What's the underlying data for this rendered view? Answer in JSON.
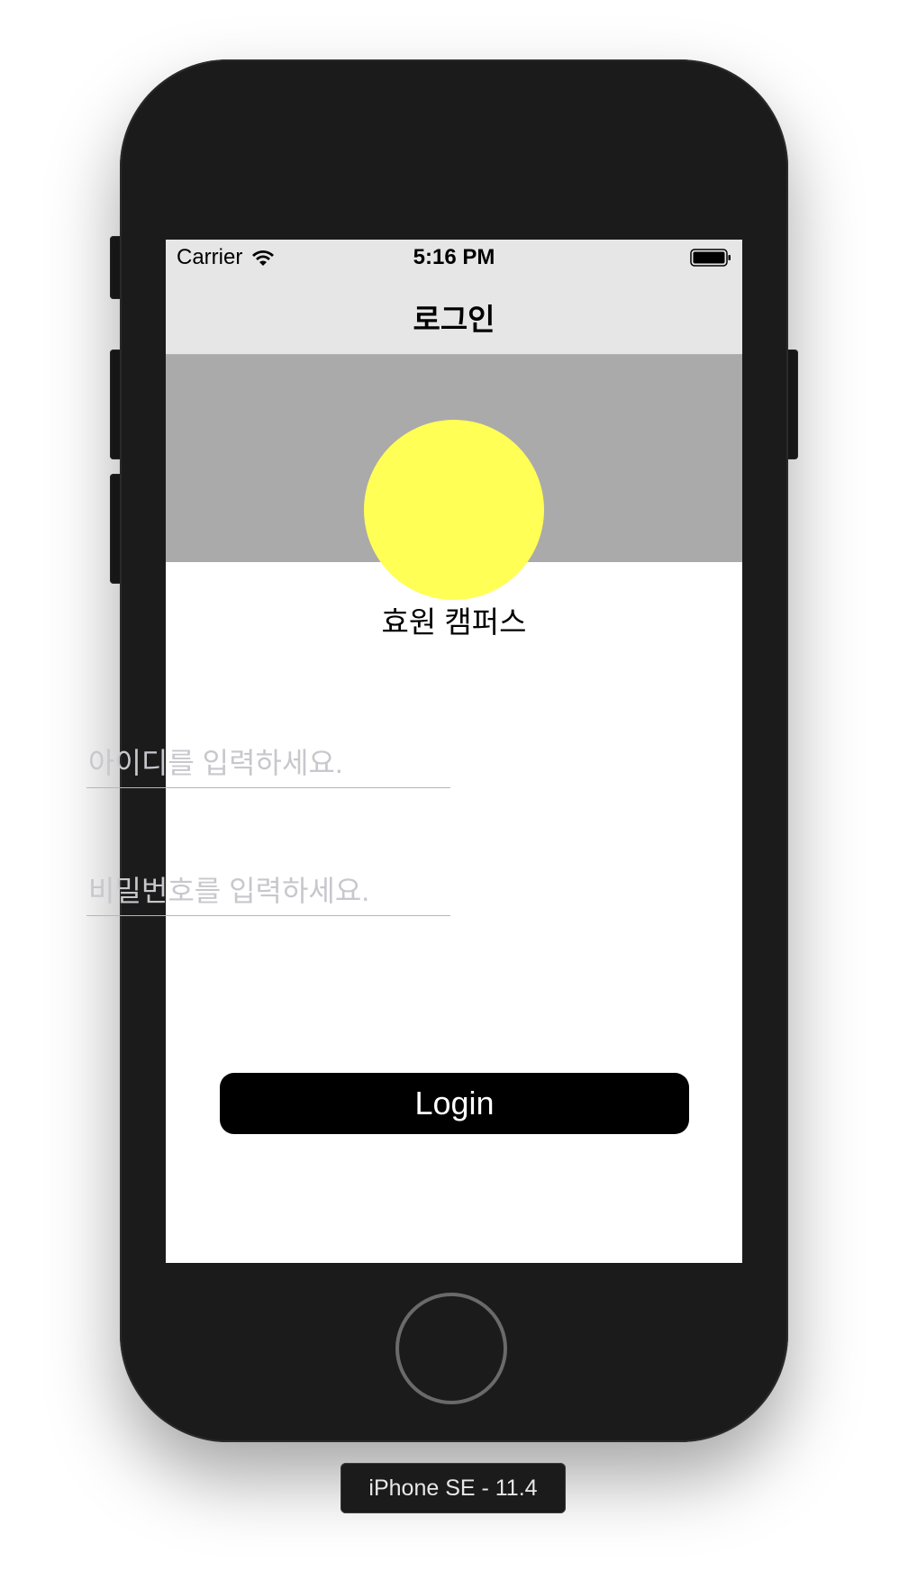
{
  "status_bar": {
    "carrier": "Carrier",
    "time": "5:16 PM",
    "wifi_icon": "wifi-icon",
    "battery_icon": "battery-full-icon"
  },
  "nav": {
    "title": "로그인"
  },
  "header": {
    "band_color": "#aaaaaa",
    "logo_color": "#ffff55",
    "campus": "효원 캠퍼스"
  },
  "form": {
    "id_placeholder": "아이디를 입력하세요.",
    "id_value": "",
    "password_placeholder": "비밀번호를 입력하세요.",
    "password_value": ""
  },
  "login": {
    "label": "Login"
  },
  "device": {
    "label": "iPhone SE - 11.4"
  }
}
